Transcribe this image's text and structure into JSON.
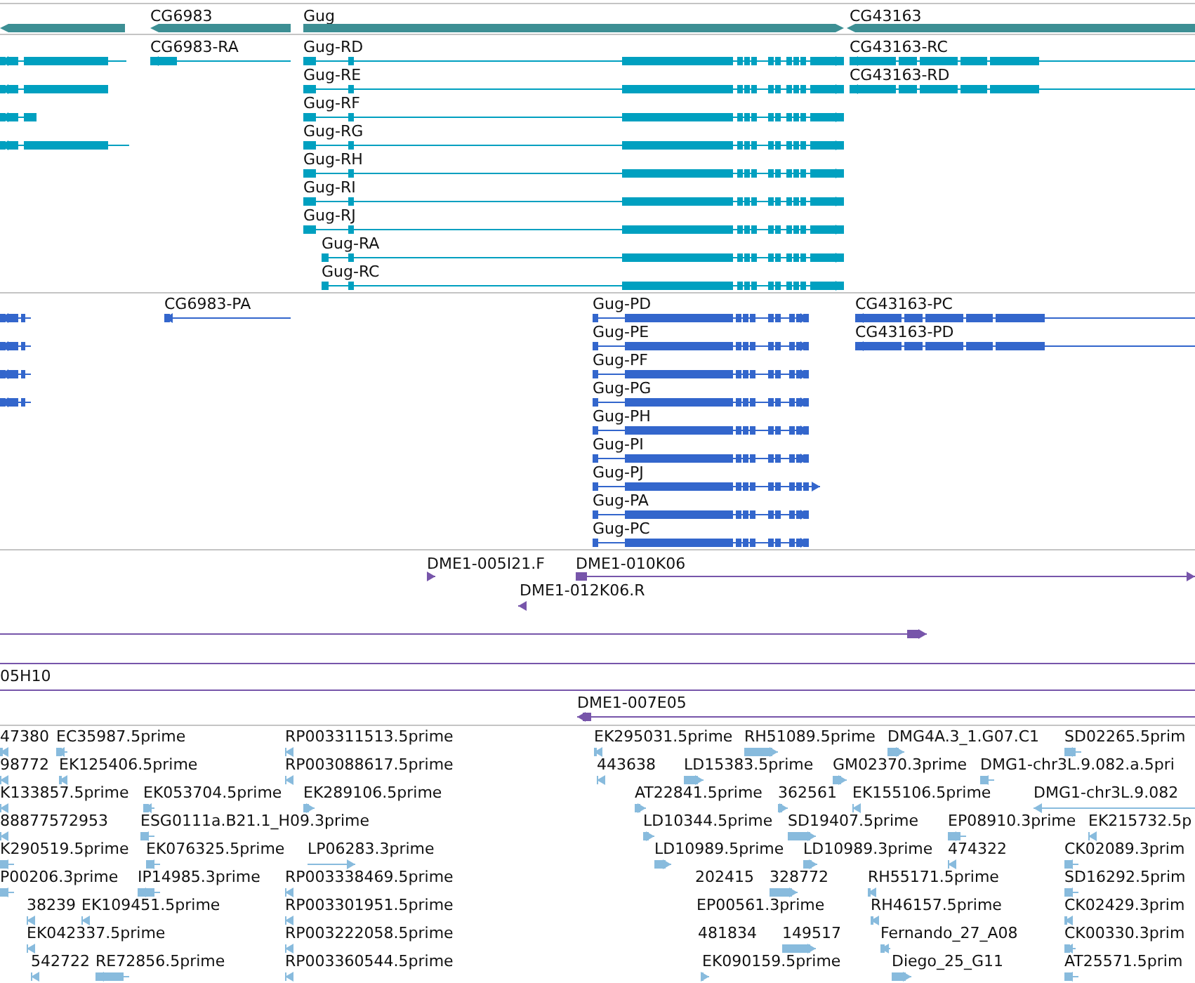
{
  "tracks": [
    {
      "kind": "gene",
      "features": [
        {
          "label": "CG6983",
          "reverse": true
        },
        {
          "label": "Gug",
          "reverse": false
        },
        {
          "label": "CG43163",
          "reverse": true
        }
      ]
    },
    {
      "kind": "transcript",
      "features": [
        {
          "label": "CG6983-RA",
          "reverse": true
        },
        {
          "label": "Gug-RD",
          "reverse": false
        },
        {
          "label": "Gug-RE",
          "reverse": false
        },
        {
          "label": "Gug-RF",
          "reverse": false
        },
        {
          "label": "Gug-RG",
          "reverse": false
        },
        {
          "label": "Gug-RH",
          "reverse": false
        },
        {
          "label": "Gug-RI",
          "reverse": false
        },
        {
          "label": "Gug-RJ",
          "reverse": false
        },
        {
          "label": "Gug-RA",
          "reverse": false
        },
        {
          "label": "Gug-RC",
          "reverse": false
        },
        {
          "label": "CG43163-RC",
          "reverse": true
        },
        {
          "label": "CG43163-RD",
          "reverse": true
        }
      ]
    },
    {
      "kind": "protein",
      "features": [
        {
          "label": "CG6983-PA",
          "reverse": true
        },
        {
          "label": "Gug-PD",
          "reverse": false
        },
        {
          "label": "Gug-PE",
          "reverse": false
        },
        {
          "label": "Gug-PF",
          "reverse": false
        },
        {
          "label": "Gug-PG",
          "reverse": false
        },
        {
          "label": "Gug-PH",
          "reverse": false
        },
        {
          "label": "Gug-PI",
          "reverse": false
        },
        {
          "label": "Gug-PJ",
          "reverse": false
        },
        {
          "label": "Gug-PA",
          "reverse": false
        },
        {
          "label": "Gug-PC",
          "reverse": false
        },
        {
          "label": "CG43163-PC",
          "reverse": true
        },
        {
          "label": "CG43163-PD",
          "reverse": true
        }
      ]
    },
    {
      "kind": "clone",
      "features": [
        {
          "label": "DME1-005I21.F",
          "reverse": false
        },
        {
          "label": "DME1-010K06",
          "reverse": false
        },
        {
          "label": "DME1-012K06.R",
          "reverse": true
        },
        {
          "label": "05H10"
        },
        {
          "label": "DME1-007E05",
          "reverse": true
        }
      ]
    },
    {
      "kind": "est",
      "features": [
        {
          "label": "47380",
          "reverse": true
        },
        {
          "label": "EC35987.5prime",
          "reverse": true
        },
        {
          "label": "RP003311513.5prime",
          "reverse": true
        },
        {
          "label": "EK295031.5prime",
          "reverse": true
        },
        {
          "label": "RH51089.5prime",
          "reverse": false
        },
        {
          "label": "DMG4A.3_1.G07.C1",
          "reverse": false
        },
        {
          "label": "SD02265.5prim",
          "reverse": true
        },
        {
          "label": "98772",
          "reverse": true
        },
        {
          "label": "EK125406.5prime",
          "reverse": true
        },
        {
          "label": "RP003088617.5prime",
          "reverse": true
        },
        {
          "label": "443638",
          "reverse": true
        },
        {
          "label": "LD15383.5prime",
          "reverse": false
        },
        {
          "label": "GM02370.3prime",
          "reverse": false
        },
        {
          "label": "DMG1-chr3L.9.082.a.5pri",
          "reverse": true
        },
        {
          "label": "K133857.5prime",
          "reverse": true
        },
        {
          "label": "EK053704.5prime",
          "reverse": true
        },
        {
          "label": "EK289106.5prime",
          "reverse": false
        },
        {
          "label": "AT22841.5prime",
          "reverse": false
        },
        {
          "label": "362561",
          "reverse": false
        },
        {
          "label": "EK155106.5prime",
          "reverse": true
        },
        {
          "label": "DMG1-chr3L.9.082",
          "reverse": true
        },
        {
          "label": "88877572953",
          "reverse": true
        },
        {
          "label": "ESG0111a.B21.1_H09.3prime",
          "reverse": true
        },
        {
          "label": "LD10344.5prime",
          "reverse": false
        },
        {
          "label": "SD19407.5prime",
          "reverse": false
        },
        {
          "label": "EP08910.3prime",
          "reverse": true
        },
        {
          "label": "EK215732.5p",
          "reverse": true
        },
        {
          "label": "K290519.5prime",
          "reverse": true
        },
        {
          "label": "EK076325.5prime",
          "reverse": true
        },
        {
          "label": "LP06283.3prime",
          "reverse": false
        },
        {
          "label": "LD10989.5prime",
          "reverse": false
        },
        {
          "label": "LD10989.3prime",
          "reverse": false
        },
        {
          "label": "474322",
          "reverse": true
        },
        {
          "label": "CK02089.3prim",
          "reverse": true
        },
        {
          "label": "P00206.3prime",
          "reverse": true
        },
        {
          "label": "IP14985.3prime",
          "reverse": true
        },
        {
          "label": "RP003338469.5prime",
          "reverse": true
        },
        {
          "label": "202415"
        },
        {
          "label": "328772",
          "reverse": false
        },
        {
          "label": "RH55171.5prime",
          "reverse": true
        },
        {
          "label": "SD16292.5prim",
          "reverse": true
        },
        {
          "label": "38239",
          "reverse": true
        },
        {
          "label": "EK109451.5prime",
          "reverse": true
        },
        {
          "label": "RP003301951.5prime",
          "reverse": true
        },
        {
          "label": "EP00561.3prime"
        },
        {
          "label": "RH46157.5prime",
          "reverse": true
        },
        {
          "label": "CK02429.3prim",
          "reverse": true
        },
        {
          "label": "EK042337.5prime",
          "reverse": true
        },
        {
          "label": "RP003222058.5prime",
          "reverse": true
        },
        {
          "label": "481834"
        },
        {
          "label": "149517",
          "reverse": false
        },
        {
          "label": "Fernando_27_A08",
          "reverse": true
        },
        {
          "label": "CK00330.3prim",
          "reverse": true
        },
        {
          "label": "542722",
          "reverse": true
        },
        {
          "label": "RE72856.5prime",
          "reverse": true
        },
        {
          "label": "RP003360544.5prime",
          "reverse": true
        },
        {
          "label": "EK090159.5prime",
          "reverse": false
        },
        {
          "label": "Diego_25_G11",
          "reverse": false
        },
        {
          "label": "AT25571.5prim",
          "reverse": true
        }
      ]
    }
  ]
}
